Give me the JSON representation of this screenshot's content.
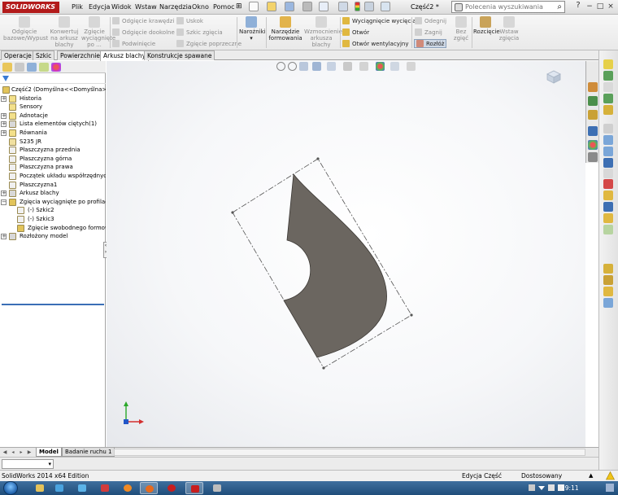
{
  "app": {
    "logo": "SOLIDWORKS",
    "document_title": "Część2 *",
    "window_buttons": [
      "−",
      "□",
      "×"
    ]
  },
  "menu": {
    "items": [
      "Plik",
      "Edycja",
      "Widok",
      "Wstaw",
      "Narzędzia",
      "Okno",
      "Pomoc"
    ],
    "pin": "⊞"
  },
  "search": {
    "placeholder": "Polecenia wyszukiwania",
    "go_glyph": "⌕"
  },
  "ribbon": {
    "big_buttons": [
      {
        "label": "Odgięcie bazowe/Wypust",
        "active": false
      },
      {
        "label": "Konwertuj na arkusz blachy",
        "active": false
      },
      {
        "label": "Zgięcie wyciągnięte po ...",
        "active": false
      },
      {
        "label": "Narożniki",
        "active": true
      },
      {
        "label": "Narzędzie formowania",
        "active": true
      },
      {
        "label": "Wzmocnienie arkusza blachy",
        "active": false
      },
      {
        "label": "Bez zgięć",
        "active": false
      },
      {
        "label": "Rozcięcie",
        "active": true
      },
      {
        "label": "Wstaw zgięcia",
        "active": false
      }
    ],
    "small_col1": [
      "Odgięcie krawędzi",
      "Odgięcie dookolne",
      "Podwinięcie"
    ],
    "small_col2": [
      "Uskok",
      "Szkic zgięcia",
      "Zgięcie poprzeczne"
    ],
    "small_col3": [
      "Wyciągnięcie wycięcia",
      "Otwór",
      "Otwór wentylacyjny"
    ],
    "small_col4": [
      "Odegnij",
      "Zagnij",
      "Rozłóż"
    ]
  },
  "tabs": {
    "items": [
      "Operacje",
      "Szkic",
      "Powierzchnie",
      "Arkusz blachy",
      "Konstrukcje spawane"
    ],
    "active": "Arkusz blachy"
  },
  "tree": {
    "root": "Część2  (Domyślna<<Domyślna>_Sta",
    "items": [
      {
        "label": "Historia",
        "indent": 1,
        "expander": "+"
      },
      {
        "label": "Sensory",
        "indent": 1,
        "expander": ""
      },
      {
        "label": "Adnotacje",
        "indent": 1,
        "expander": "+"
      },
      {
        "label": "Lista elementów ciętych(1)",
        "indent": 1,
        "expander": "+"
      },
      {
        "label": "Równania",
        "indent": 1,
        "expander": "+"
      },
      {
        "label": "S235 JR",
        "indent": 1,
        "expander": ""
      },
      {
        "label": "Płaszczyzna przednia",
        "indent": 1,
        "expander": ""
      },
      {
        "label": "Płaszczyzna górna",
        "indent": 1,
        "expander": ""
      },
      {
        "label": "Płaszczyzna prawa",
        "indent": 1,
        "expander": ""
      },
      {
        "label": "Początek układu współrzędnych",
        "indent": 1,
        "expander": ""
      },
      {
        "label": "Płaszczyzna1",
        "indent": 1,
        "expander": ""
      },
      {
        "label": "Arkusz blachy",
        "indent": 1,
        "expander": "+"
      },
      {
        "label": "Zgięcia wyciągnięte po profilach1",
        "indent": 1,
        "expander": "−"
      },
      {
        "label": "(-) Szkic2",
        "indent": 2,
        "expander": ""
      },
      {
        "label": "(-) Szkic3",
        "indent": 2,
        "expander": ""
      },
      {
        "label": "Zgięcie swobodnego formow",
        "indent": 2,
        "expander": ""
      },
      {
        "label": "Rozłożony model",
        "indent": 1,
        "expander": "+"
      }
    ]
  },
  "bottom": {
    "tabs": [
      "Model",
      "Badanie ruchu 1"
    ],
    "active_tab": "Model"
  },
  "status": {
    "edition": "SolidWorks 2014 x64 Edition",
    "mode": "Edycja Część",
    "units": "Dostosowany",
    "units_arrow": "▲"
  },
  "taskbar": {
    "time": "19:11"
  },
  "colors": {
    "part_fill": "#6b6660",
    "part_edge": "#3a3733",
    "accent": "#3b6fb6",
    "brand": "#b31b1b"
  }
}
